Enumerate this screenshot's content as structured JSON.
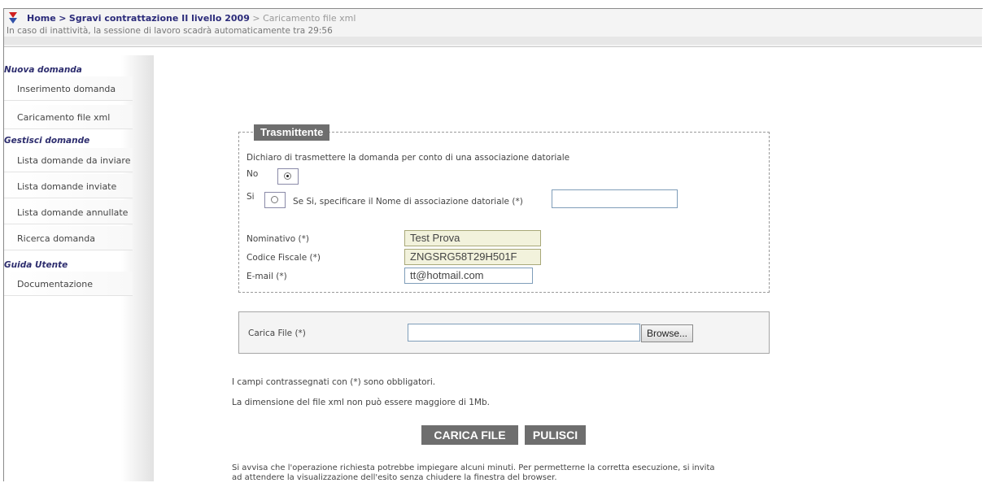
{
  "header": {
    "breadcrumb_home": "Home",
    "breadcrumb_section": "Sgravi contrattazione II livello 2009",
    "breadcrumb_current": "Caricamento file xml",
    "separator": ">",
    "session_text": "In caso di inattività, la sessione di lavoro scadrà automaticamente tra 29:56"
  },
  "sidebar": {
    "sections": [
      {
        "title": "Nuova domanda",
        "items": [
          "Inserimento domanda",
          "Caricamento file xml"
        ]
      },
      {
        "title": "Gestisci domande",
        "items": [
          "Lista domande da inviare",
          "Lista domande inviate",
          "Lista domande annullate",
          "Ricerca domanda"
        ]
      },
      {
        "title": "Guida Utente",
        "items": [
          "Documentazione"
        ]
      }
    ]
  },
  "form": {
    "legend": "Trasmittente",
    "declaration": "Dichiaro di trasmettere la domanda per conto di una associazione datoriale",
    "option_no": "No",
    "option_si": "Si",
    "selected": "No",
    "association_label": "Se Si, specificare il Nome di associazione datoriale (*)",
    "association_value": "",
    "nominativo_label": "Nominativo (*)",
    "nominativo_value": "Test Prova",
    "codice_label": "Codice Fiscale (*)",
    "codice_value": "ZNGSRG58T29H501F",
    "email_label": "E-mail (*)",
    "email_value": "tt@hotmail.com"
  },
  "upload": {
    "label": "Carica File (*)",
    "value": "",
    "browse_label": "Browse..."
  },
  "notes": {
    "required": "I campi contrassegnati con (*) sono obbligatori.",
    "size": "La dimensione del file xml non può essere maggiore di 1Mb.",
    "notice_line1": "Si avvisa che l'operazione richiesta potrebbe impiegare alcuni minuti. Per permetterne la corretta esecuzione, si invita",
    "notice_line2": "ad attendere la visualizzazione dell'esito senza chiudere la finestra del browser."
  },
  "buttons": {
    "upload": "CARICA FILE",
    "clear": "PULISCI"
  },
  "colors": {
    "accent": "#2d2d6e",
    "button_bg": "#6e6e6e",
    "readonly_bg": "#f2f2dc"
  }
}
